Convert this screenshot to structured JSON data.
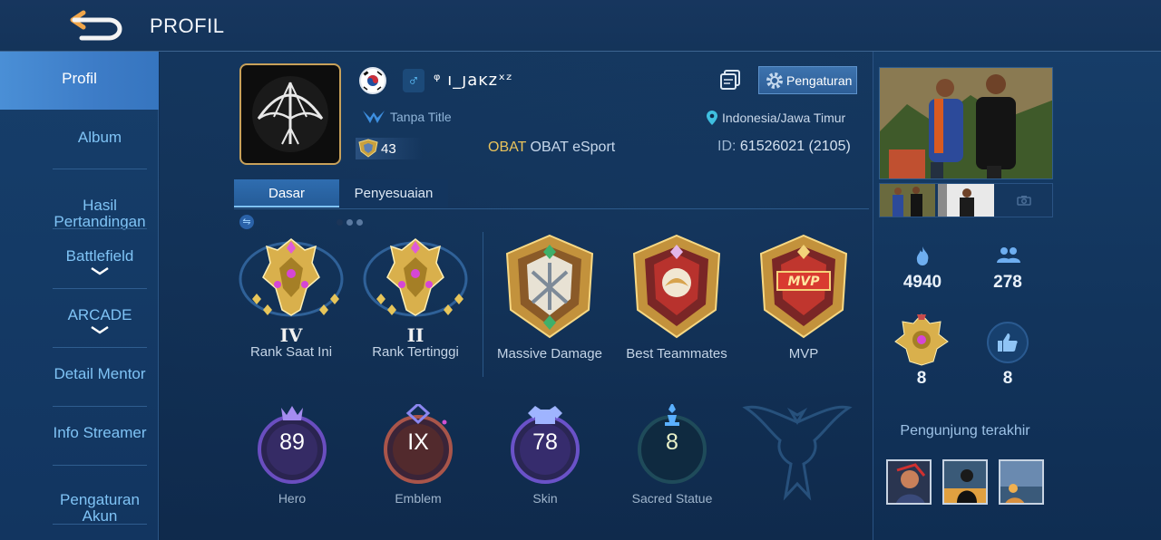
{
  "header": {
    "title": "PROFIL",
    "back_icon": "back-arrow-icon"
  },
  "sidebar": {
    "items": [
      {
        "label": "Profil",
        "active": true
      },
      {
        "label": "Album"
      },
      {
        "label": "Hasil\nPertandingan"
      },
      {
        "label": "Battlefield",
        "expandable": true
      },
      {
        "label": "ARCADE",
        "expandable": true
      },
      {
        "label": "Detail Mentor"
      },
      {
        "label": "Info Streamer"
      },
      {
        "label": "Pengaturan\nAkun"
      }
    ]
  },
  "player": {
    "name": "ᵠ ı_ȷaĸzˣᶻ",
    "gender_symbol": "♂",
    "title": "Tanpa Title",
    "level": "43",
    "squad_tag": "OBAT",
    "squad_name": "OBAT eSport",
    "location": "Indonesia/Jawa Timur",
    "id_label": "ID:",
    "id_value": "61526021 (2105)",
    "settings_label": "Pengaturan"
  },
  "tabs": [
    {
      "label": "Dasar",
      "active": true
    },
    {
      "label": "Penyesuaian"
    }
  ],
  "badges": [
    {
      "roman": "IV",
      "label": "Rank Saat Ini"
    },
    {
      "roman": "II",
      "label": "Rank Tertinggi"
    },
    {
      "label": "Massive Damage"
    },
    {
      "label": "Best Teammates"
    },
    {
      "label": "MVP",
      "emblem_text": "MVP"
    }
  ],
  "stats": [
    {
      "value": "89",
      "label": "Hero",
      "color": "#8a5fd6"
    },
    {
      "value": "IX",
      "label": "Emblem",
      "color": "#c86d4a"
    },
    {
      "value": "78",
      "label": "Skin",
      "color": "#7a5fd0"
    },
    {
      "value": "8",
      "label": "Sacred Statue",
      "color": "#3a6b5b"
    }
  ],
  "right": {
    "popularity": "4940",
    "followers": "278",
    "medals": "8",
    "likes": "8",
    "recent_visitors_label": "Pengunjung terakhir"
  },
  "colors": {
    "accent": "#3d7cc7",
    "gold": "#e9c35b",
    "panel": "#13355e"
  }
}
